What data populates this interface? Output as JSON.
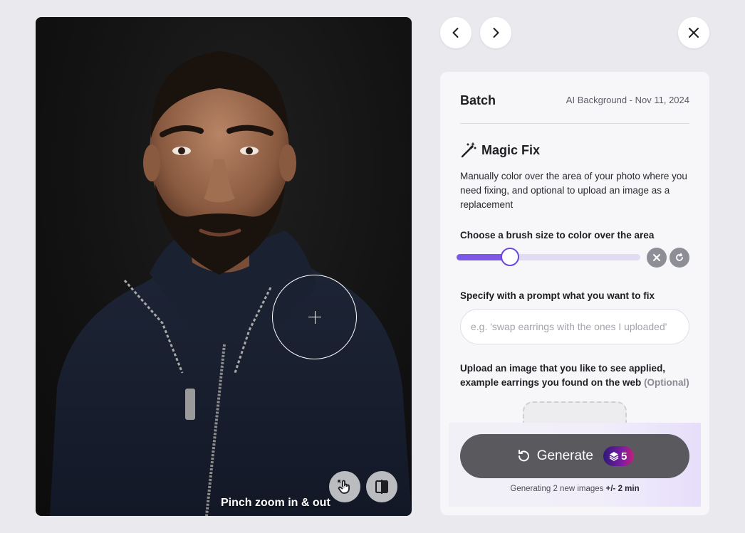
{
  "photo": {
    "zoom_hint": "Pinch zoom in & out",
    "icons": {
      "pinch": "pinch-gesture-icon",
      "compare": "compare-split-icon",
      "crosshair": "crosshair-icon"
    }
  },
  "nav": {
    "icons": {
      "prev": "chevron-left-icon",
      "next": "chevron-right-icon",
      "close": "close-icon"
    }
  },
  "panel": {
    "title": "Batch",
    "meta": "AI Background - Nov 11, 2024",
    "magic_fix": {
      "title": "Magic Fix",
      "icon": "magic-wand-icon",
      "description": "Manually color over the area of your photo where you need fixing, and optional to upload an image as a replacement"
    },
    "brush": {
      "label": "Choose a brush size to color over the area",
      "value_fraction": 0.29,
      "icons": {
        "clear": "clear-x-icon",
        "reset": "reset-icon"
      }
    },
    "prompt": {
      "label": "Specify with a prompt what you want to fix",
      "placeholder": "e.g. 'swap earrings with the ones I uploaded'",
      "value": ""
    },
    "upload": {
      "label_line1": "Upload an image that you like to see applied,",
      "label_line2": "example earrings you found on the web",
      "optional": "(Optional)"
    },
    "generate": {
      "label": "Generate",
      "credits": "5",
      "icons": {
        "refresh": "refresh-icon",
        "credits": "layers-icon"
      },
      "note_prefix": "Generating 2 new images",
      "note_time": "+/- 2 min"
    }
  },
  "colors": {
    "accent": "#7d58e8",
    "slider_track": "#e3daf4",
    "button_dark": "#59595e",
    "badge_gradient_start": "#2e1a7a",
    "badge_gradient_end": "#c0207a"
  }
}
